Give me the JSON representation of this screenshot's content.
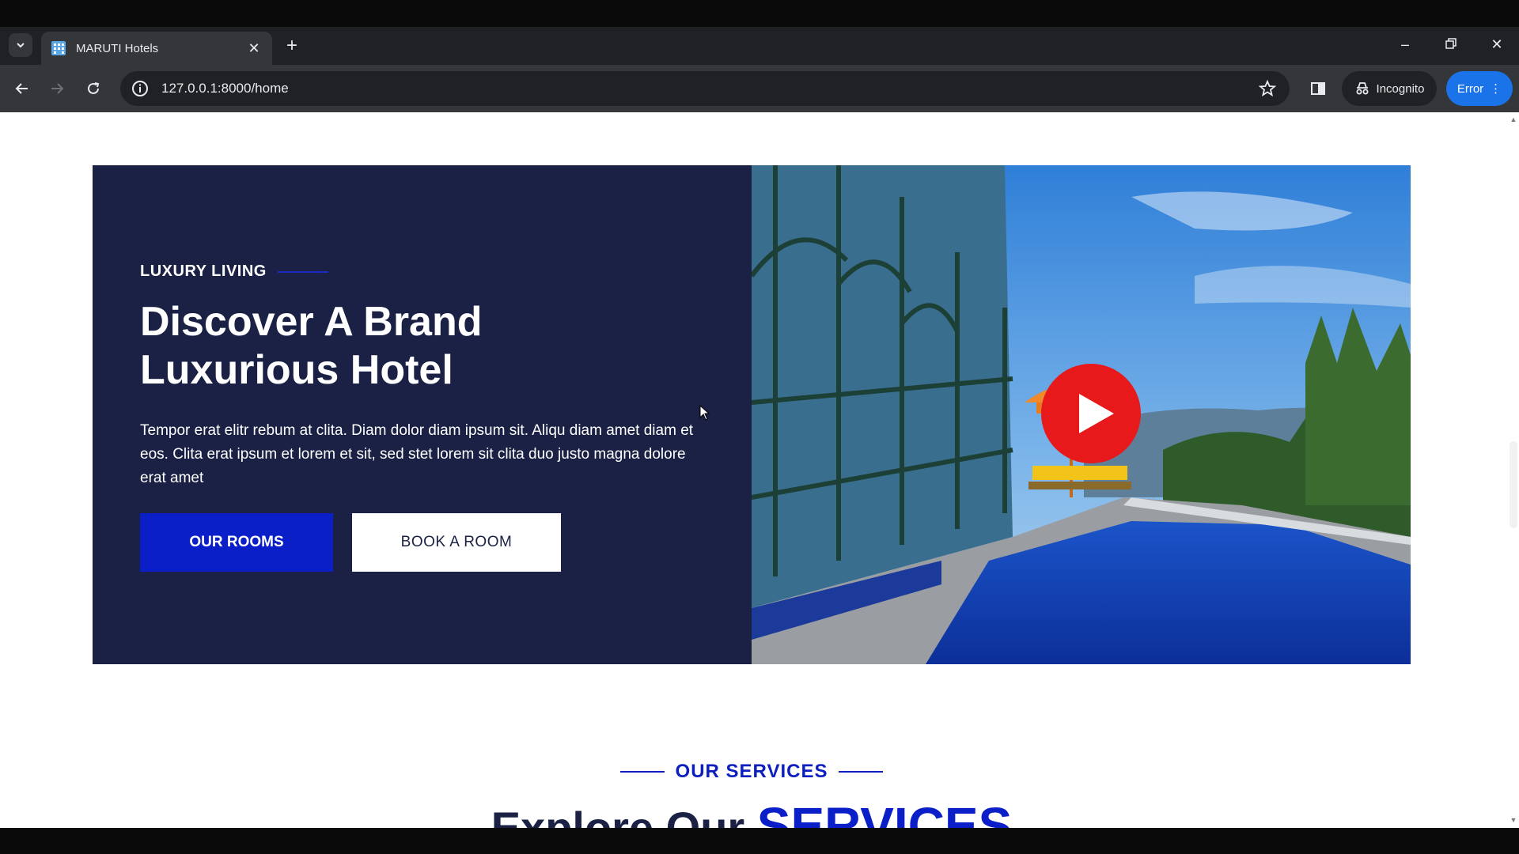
{
  "browser": {
    "tab_title": "MARUTI Hotels",
    "url": "127.0.0.1:8000/home",
    "incognito_label": "Incognito",
    "error_label": "Error"
  },
  "hero": {
    "eyebrow": "LUXURY LIVING",
    "title_line1": "Discover A Brand",
    "title_line2": "Luxurious Hotel",
    "description": "Tempor erat elitr rebum at clita. Diam dolor diam ipsum sit. Aliqu diam amet diam et eos. Clita erat ipsum et lorem et sit, sed stet lorem sit clita duo justo magna dolore erat amet",
    "primary_button": "OUR ROOMS",
    "secondary_button": "BOOK A ROOM"
  },
  "services": {
    "eyebrow": "OUR SERVICES",
    "heading_plain": "Explore Our",
    "heading_accent": "SERVICES"
  },
  "colors": {
    "navy": "#1b2144",
    "brand_blue": "#0b1fc9",
    "play_red": "#e8191a"
  },
  "icons": {
    "tab_list": "chevron-down-icon",
    "favicon": "building-icon",
    "close": "close-icon",
    "new_tab": "plus-icon",
    "back": "arrow-left-icon",
    "forward": "arrow-right-icon",
    "reload": "reload-icon",
    "site_info": "info-icon",
    "bookmark": "star-icon",
    "side_panel": "side-panel-icon",
    "incognito": "incognito-icon",
    "menu": "kebab-menu-icon",
    "play": "play-icon"
  }
}
